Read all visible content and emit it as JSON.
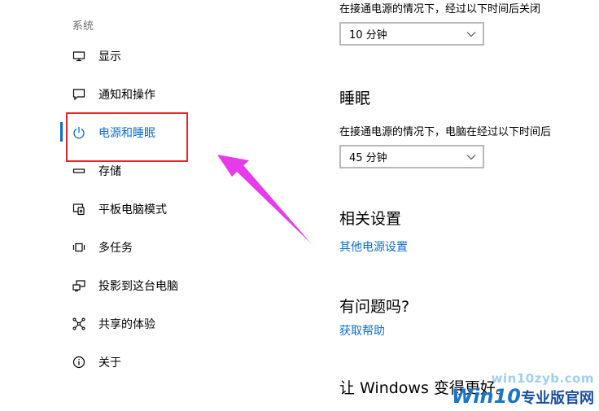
{
  "sidebar": {
    "section_label": "系统",
    "items": [
      {
        "label": "显示",
        "icon": "monitor-icon"
      },
      {
        "label": "通知和操作",
        "icon": "notification-icon"
      },
      {
        "label": "电源和睡眠",
        "icon": "power-icon"
      },
      {
        "label": "存储",
        "icon": "storage-icon"
      },
      {
        "label": "平板电脑模式",
        "icon": "tablet-mode-icon"
      },
      {
        "label": "多任务",
        "icon": "multitask-icon"
      },
      {
        "label": "投影到这台电脑",
        "icon": "project-icon"
      },
      {
        "label": "共享的体验",
        "icon": "shared-experience-icon"
      },
      {
        "label": "关于",
        "icon": "info-icon"
      }
    ],
    "active_item": "电源和睡眠"
  },
  "main": {
    "screen_off_label": "在接通电源的情况下，经过以下时间后关闭",
    "screen_off_value": "10 分钟",
    "sleep_heading": "睡眠",
    "sleep_label": "在接通电源的情况下，电脑在经过以下时间后",
    "sleep_value": "45 分钟",
    "related_heading": "相关设置",
    "related_link": "其他电源设置",
    "question_heading": "有问题吗?",
    "help_link": "获取帮助",
    "feedback_heading": "让 Windows 变得更好。"
  },
  "watermark": {
    "url": "win10zyb.com",
    "logo_text": "Win10",
    "logo_cn": "专业版官网"
  },
  "colors": {
    "accent": "#0a6fcf",
    "highlight_box": "#e8262a",
    "arrow": "#e63be8"
  }
}
